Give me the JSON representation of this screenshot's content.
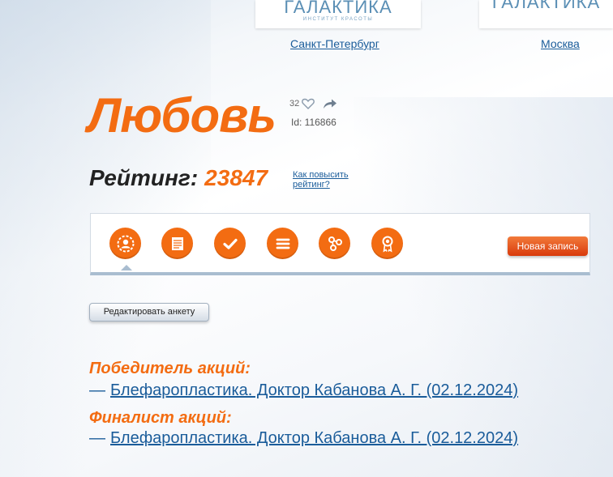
{
  "salons": [
    {
      "brand": "ГАЛАКТИКА",
      "tagline": "ИНСТИТУТ КРАСОТЫ",
      "city": "Санкт-Петербург"
    },
    {
      "brand": "ГАЛАКТИКА",
      "city": "Москва"
    }
  ],
  "profile": {
    "name": "Любовь",
    "likes_count": "32",
    "id_label": "Id: 116866"
  },
  "rating": {
    "label": "Рейтинг:",
    "value": "23847",
    "help_link": "Как повысить рейтинг?"
  },
  "toolbar": {
    "icons": [
      "profile-icon",
      "notes-icon",
      "check-icon",
      "list-icon",
      "connections-icon",
      "award-icon"
    ],
    "active_index": 0,
    "new_entry_label": "Новая запись"
  },
  "edit_button_label": "Редактировать анкету",
  "awards": [
    {
      "heading": "Победитель акций:",
      "dash": "—",
      "item": "Блефаропластика. Доктор Кабанова А. Г. (02.12.2024)"
    },
    {
      "heading": "Финалист акций:",
      "dash": "—",
      "item": "Блефаропластика. Доктор Кабанова А. Г. (02.12.2024)"
    }
  ],
  "colors": {
    "accent": "#f36c12",
    "link": "#1a5c9a",
    "brand": "#5b8fb5"
  }
}
